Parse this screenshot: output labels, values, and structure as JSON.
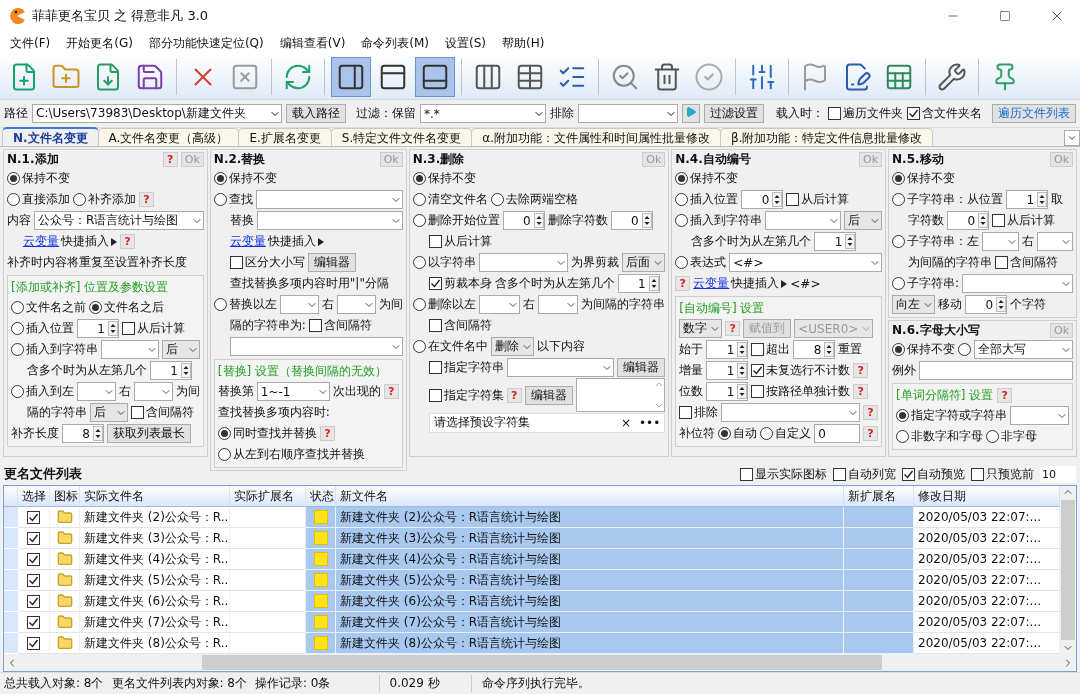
{
  "window": {
    "title": "菲菲更名宝贝 之 得意非凡 3.0"
  },
  "menu": [
    "文件(F)",
    "开始更名(G)",
    "部分功能快速定位(Q)",
    "编辑查看(V)",
    "命令列表(M)",
    "设置(S)",
    "帮助(H)"
  ],
  "toolbar": {
    "groups": [
      [
        {
          "selected": false
        },
        {
          "selected": false
        },
        {
          "selected": false
        },
        {
          "selected": false
        }
      ],
      [
        {
          "selected": false
        },
        {
          "selected": false
        }
      ],
      [
        {
          "selected": false
        }
      ],
      [
        {
          "selected": true
        },
        {
          "selected": false
        },
        {
          "selected": true
        }
      ],
      [
        {
          "selected": false
        },
        {
          "selected": false
        },
        {
          "selected": false
        }
      ],
      [
        {
          "selected": false
        },
        {
          "selected": false
        },
        {
          "selected": false
        }
      ],
      [
        {
          "selected": false
        }
      ],
      [
        {
          "selected": false
        },
        {
          "selected": false
        },
        {
          "selected": false
        }
      ],
      [
        {
          "selected": false
        }
      ],
      [
        {
          "selected": false
        }
      ]
    ]
  },
  "path_bar": {
    "path_label": "路径",
    "path": "C:\\Users\\73983\\Desktop\\新建文件夹",
    "load_button": "载入路径",
    "filter_label": "过滤：保留",
    "filter": "*.*",
    "exclude_label": "排除",
    "filter_settings_button": "过滤设置",
    "on_load_label": "载入时：",
    "options": [
      {
        "label": "遍历文件夹",
        "checked": false
      },
      {
        "label": "含文件夹名",
        "checked": true
      }
    ],
    "traverse_button": "遍历文件列表"
  },
  "tabs": [
    {
      "label": "N.文件名变更",
      "selected": true
    },
    {
      "label": "A.文件名变更（高级）",
      "selected": false
    },
    {
      "label": "E.扩展名变更",
      "selected": false
    },
    {
      "label": "S.特定文件文件名变更",
      "selected": false
    },
    {
      "label": "α.附加功能：文件属性和时间属性批量修改",
      "selected": false
    },
    {
      "label": "β.附加功能：特定文件信息批量修改",
      "selected": false
    }
  ],
  "columns": [
    {
      "panels": [
        {
          "title": "N.1.添加",
          "help": "?",
          "ok": {
            "label": "Ok",
            "disabled": true
          },
          "lines": [
            {
              "items": [
                {
                  "kind": "radio",
                  "label": "保持不变",
                  "selected": true
                }
              ]
            },
            {
              "items": [
                {
                  "kind": "radio",
                  "label": "直接添加",
                  "selected": false
                },
                {
                  "kind": "radio",
                  "label": "补齐添加",
                  "selected": false
                },
                {
                  "kind": "help",
                  "text": "?"
                }
              ]
            },
            {
              "items": [
                {
                  "kind": "text",
                  "text": "内容"
                },
                {
                  "kind": "combo",
                  "value": "公众号：R语言统计与绘图"
                }
              ],
              "children": [
                {
                  "items": [
                    {
                      "kind": "link",
                      "link": "云变量",
                      "text": "快捷插入"
                    },
                    {
                      "kind": "help",
                      "text": "?"
                    }
                  ]
                }
              ]
            },
            {
              "items": [
                {
                  "kind": "text",
                  "text": "补齐时内容将重复至设置补齐长度"
                }
              ]
            }
          ],
          "sections": [
            {
              "title": "[添加或补齐] 位置及参数设置",
              "lines": [
                {
                  "items": [
                    {
                      "kind": "radio",
                      "label": "文件名之前",
                      "selected": false
                    },
                    {
                      "kind": "radio",
                      "label": "文件名之后",
                      "selected": true
                    }
                  ]
                },
                {
                  "items": [
                    {
                      "kind": "radio",
                      "label": "插入位置",
                      "selected": false
                    },
                    {
                      "kind": "spin",
                      "value": "1"
                    },
                    {
                      "kind": "check",
                      "label": "从后计算",
                      "checked": false
                    }
                  ]
                },
                {
                  "items": [
                    {
                      "kind": "radio",
                      "label": "插入到字符串",
                      "selected": false
                    },
                    {
                      "kind": "combo"
                    },
                    {
                      "kind": "select",
                      "value": "后"
                    }
                  ],
                  "children": [
                    {
                      "items": [
                        {
                          "kind": "text",
                          "text": "含多个时为从左第几个"
                        },
                        {
                          "kind": "spin",
                          "value": "1"
                        }
                      ]
                    }
                  ]
                },
                {
                  "items": [
                    {
                      "kind": "radio",
                      "label": "插入到左",
                      "selected": false
                    },
                    {
                      "kind": "combo"
                    },
                    {
                      "kind": "text",
                      "text": "右"
                    },
                    {
                      "kind": "combo"
                    },
                    {
                      "kind": "text",
                      "text": "为间"
                    }
                  ],
                  "children": [
                    {
                      "items": [
                        {
                          "kind": "text",
                          "text": "隔的字符串"
                        },
                        {
                          "kind": "select",
                          "value": "后"
                        },
                        {
                          "kind": "check",
                          "label": "含间隔符",
                          "checked": false
                        }
                      ]
                    }
                  ]
                },
                {
                  "items": [
                    {
                      "kind": "text",
                      "text": "补齐长度"
                    },
                    {
                      "kind": "spin",
                      "value": "8"
                    },
                    {
                      "kind": "button",
                      "label": "获取列表最长"
                    }
                  ]
                }
              ]
            }
          ]
        }
      ]
    },
    {
      "panels": [
        {
          "title": "N.2.替换",
          "ok": {
            "label": "Ok",
            "disabled": true
          },
          "lines": [
            {
              "items": [
                {
                  "kind": "radio",
                  "label": "保持不变",
                  "selected": true
                }
              ]
            },
            {
              "items": [
                {
                  "kind": "radio",
                  "label": "查找",
                  "selected": false
                },
                {
                  "kind": "combo"
                }
              ],
              "children": [
                {
                  "items": [
                    {
                      "kind": "text",
                      "text": "替换"
                    },
                    {
                      "kind": "combo"
                    }
                  ]
                },
                {
                  "items": [
                    {
                      "kind": "link",
                      "link": "云变量",
                      "text": "快捷插入"
                    }
                  ]
                },
                {
                  "items": [
                    {
                      "kind": "check",
                      "label": "区分大小写",
                      "checked": false
                    },
                    {
                      "kind": "button",
                      "label": "编辑器"
                    }
                  ]
                },
                {
                  "items": [
                    {
                      "kind": "text",
                      "text": "查找替换多项内容时用\"|\"分隔"
                    }
                  ]
                }
              ]
            },
            {
              "items": [
                {
                  "kind": "radio",
                  "label": "替换以左",
                  "selected": false
                },
                {
                  "kind": "combo"
                },
                {
                  "kind": "text",
                  "text": "右"
                },
                {
                  "kind": "combo"
                },
                {
                  "kind": "text",
                  "text": "为间"
                }
              ],
              "children": [
                {
                  "items": [
                    {
                      "kind": "text",
                      "text": "隔的字符串为:"
                    },
                    {
                      "kind": "check",
                      "label": "含间隔符",
                      "checked": false
                    }
                  ]
                },
                {
                  "items": [
                    {
                      "kind": "combo"
                    }
                  ]
                }
              ]
            }
          ],
          "sections": [
            {
              "title": "[替换] 设置（替换间隔的无效）",
              "lines": [
                {
                  "items": [
                    {
                      "kind": "text",
                      "text": "替换第"
                    },
                    {
                      "kind": "combo",
                      "value": "1~-1"
                    },
                    {
                      "kind": "text",
                      "text": "次出现的"
                    },
                    {
                      "kind": "help",
                      "text": "?"
                    }
                  ]
                },
                {
                  "items": [
                    {
                      "kind": "text",
                      "text": "查找替换多项内容时:"
                    }
                  ]
                },
                {
                  "items": [
                    {
                      "kind": "radio",
                      "label": "同时查找并替换",
                      "selected": true
                    },
                    {
                      "kind": "help",
                      "text": "?"
                    }
                  ]
                },
                {
                  "items": [
                    {
                      "kind": "radio",
                      "label": "从左到右顺序查找并替换",
                      "selected": false
                    }
                  ]
                }
              ]
            }
          ]
        }
      ]
    },
    {
      "panels": [
        {
          "title": "N.3.删除",
          "ok": {
            "label": "Ok",
            "disabled": true
          },
          "lines": [
            {
              "items": [
                {
                  "kind": "radio",
                  "label": "保持不变",
                  "selected": true
                }
              ]
            },
            {
              "items": [
                {
                  "kind": "radio",
                  "label": "清空文件名",
                  "selected": false
                },
                {
                  "kind": "radio",
                  "label": "去除两端空格",
                  "selected": false
                }
              ]
            },
            {
              "items": [
                {
                  "kind": "radio",
                  "label": "删除开始位置",
                  "selected": false
                },
                {
                  "kind": "spin",
                  "value": "0"
                },
                {
                  "kind": "text",
                  "text": "删除字符数"
                },
                {
                  "kind": "spin",
                  "value": "0"
                }
              ],
              "children": [
                {
                  "items": [
                    {
                      "kind": "check",
                      "label": "从后计算",
                      "checked": false
                    }
                  ]
                }
              ]
            },
            {
              "items": [
                {
                  "kind": "radio",
                  "label": "以字符串",
                  "selected": false
                },
                {
                  "kind": "combo"
                },
                {
                  "kind": "text",
                  "text": "为界剪裁"
                },
                {
                  "kind": "select",
                  "value": "后面"
                }
              ],
              "children": [
                {
                  "items": [
                    {
                      "kind": "check",
                      "label": "剪裁本身",
                      "checked": true
                    },
                    {
                      "kind": "text",
                      "text": "含多个时为从左第几个"
                    },
                    {
                      "kind": "spin",
                      "value": "1"
                    }
                  ]
                }
              ]
            },
            {
              "items": [
                {
                  "kind": "radio",
                  "label": "删除以左",
                  "selected": false
                },
                {
                  "kind": "combo"
                },
                {
                  "kind": "text",
                  "text": "右"
                },
                {
                  "kind": "combo"
                },
                {
                  "kind": "text",
                  "text": "为间隔的字符串"
                }
              ],
              "children": [
                {
                  "items": [
                    {
                      "kind": "check",
                      "label": "含间隔符",
                      "checked": false
                    }
                  ]
                }
              ]
            },
            {
              "items": [
                {
                  "kind": "radio",
                  "label": "在文件名中",
                  "selected": false
                },
                {
                  "kind": "select",
                  "value": "删除"
                },
                {
                  "kind": "text",
                  "text": "以下内容"
                }
              ],
              "children": [
                {
                  "items": [
                    {
                      "kind": "check",
                      "label": "指定字符串",
                      "checked": false
                    },
                    {
                      "kind": "combo"
                    },
                    {
                      "kind": "button",
                      "label": "编辑器"
                    }
                  ]
                },
                {
                  "items": [
                    {
                      "kind": "check",
                      "label": "指定字符集",
                      "checked": false
                    },
                    {
                      "kind": "help",
                      "text": "?"
                    },
                    {
                      "kind": "button",
                      "label": "编辑器"
                    },
                    {
                      "kind": "memo"
                    }
                  ]
                },
                {
                  "items": [
                    {
                      "kind": "picker",
                      "value": "请选择预设字符集",
                      "clear": "×",
                      "more": "•••"
                    }
                  ]
                }
              ]
            }
          ]
        }
      ]
    },
    {
      "panels": [
        {
          "title": "N.4.自动编号",
          "ok": {
            "label": "Ok",
            "disabled": true
          },
          "lines": [
            {
              "items": [
                {
                  "kind": "radio",
                  "label": "保持不变",
                  "selected": true
                }
              ]
            },
            {
              "items": [
                {
                  "kind": "radio",
                  "label": "插入位置",
                  "selected": false
                },
                {
                  "kind": "spin",
                  "value": "0"
                },
                {
                  "kind": "check",
                  "label": "从后计算",
                  "checked": false
                }
              ]
            },
            {
              "items": [
                {
                  "kind": "radio",
                  "label": "插入到字符串",
                  "selected": false
                },
                {
                  "kind": "combo"
                },
                {
                  "kind": "select",
                  "value": "后"
                }
              ],
              "children": [
                {
                  "items": [
                    {
                      "kind": "text",
                      "text": "含多个时为从左第几个"
                    },
                    {
                      "kind": "spin",
                      "value": "1"
                    }
                  ]
                }
              ]
            },
            {
              "items": [
                {
                  "kind": "radio",
                  "label": "表达式",
                  "selected": false
                },
                {
                  "kind": "combo",
                  "value": "<#>"
                }
              ]
            },
            {
              "items": [
                {
                  "kind": "help",
                  "text": "?"
                },
                {
                  "kind": "link",
                  "link": "云变量",
                  "text": "快捷插入"
                },
                {
                  "kind": "text",
                  "text": "<#>"
                }
              ]
            }
          ],
          "sections": [
            {
              "title": "[自动编号] 设置",
              "lines": [
                {
                  "items": [
                    {
                      "kind": "select",
                      "value": "数字"
                    },
                    {
                      "kind": "help",
                      "text": "?"
                    },
                    {
                      "kind": "button",
                      "label": "赋值到",
                      "disabled": true
                    },
                    {
                      "kind": "select",
                      "value": "<USER0>",
                      "disabled": true
                    }
                  ]
                },
                {
                  "items": [
                    {
                      "kind": "text",
                      "text": "始于"
                    },
                    {
                      "kind": "spin",
                      "value": "1"
                    },
                    {
                      "kind": "check",
                      "label": "超出",
                      "checked": false
                    },
                    {
                      "kind": "spin",
                      "value": "8"
                    },
                    {
                      "kind": "text",
                      "text": "重置"
                    }
                  ]
                },
                {
                  "items": [
                    {
                      "kind": "text",
                      "text": "增量"
                    },
                    {
                      "kind": "spin",
                      "value": "1"
                    },
                    {
                      "kind": "check",
                      "label": "未复选行不计数",
                      "checked": true
                    },
                    {
                      "kind": "help",
                      "text": "?"
                    }
                  ]
                },
                {
                  "items": [
                    {
                      "kind": "text",
                      "text": "位数"
                    },
                    {
                      "kind": "spin",
                      "value": "1"
                    },
                    {
                      "kind": "check",
                      "label": "按路径单独计数",
                      "checked": false
                    },
                    {
                      "kind": "help",
                      "text": "?"
                    }
                  ]
                },
                {
                  "items": [
                    {
                      "kind": "check",
                      "label": "排除",
                      "checked": false
                    },
                    {
                      "kind": "combo"
                    },
                    {
                      "kind": "help",
                      "text": "?"
                    }
                  ]
                },
                {
                  "items": [
                    {
                      "kind": "text",
                      "text": "补位符"
                    },
                    {
                      "kind": "radio",
                      "label": "自动",
                      "selected": true
                    },
                    {
                      "kind": "radio",
                      "label": "自定义",
                      "selected": false
                    },
                    {
                      "kind": "input",
                      "value": "0"
                    },
                    {
                      "kind": "help",
                      "text": "?"
                    }
                  ]
                }
              ]
            }
          ]
        }
      ]
    },
    {
      "panels": [
        {
          "title": "N.5.移动",
          "ok": {
            "label": "Ok",
            "disabled": true
          },
          "lines": [
            {
              "items": [
                {
                  "kind": "radio",
                  "label": "保持不变",
                  "selected": true
                }
              ]
            },
            {
              "items": [
                {
                  "kind": "radio",
                  "label": "子字符串：从位置",
                  "selected": false
                },
                {
                  "kind": "spin",
                  "value": "1"
                },
                {
                  "kind": "text",
                  "text": "取"
                }
              ],
              "children": [
                {
                  "items": [
                    {
                      "kind": "text",
                      "text": "字符数"
                    },
                    {
                      "kind": "spin",
                      "value": "0"
                    },
                    {
                      "kind": "check",
                      "label": "从后计算",
                      "checked": false
                    }
                  ]
                }
              ]
            },
            {
              "items": [
                {
                  "kind": "radio",
                  "label": "子字符串：左",
                  "selected": false
                },
                {
                  "kind": "combo"
                },
                {
                  "kind": "text",
                  "text": "右"
                },
                {
                  "kind": "combo"
                }
              ],
              "children": [
                {
                  "items": [
                    {
                      "kind": "text",
                      "text": "为间隔的字符串"
                    },
                    {
                      "kind": "check",
                      "label": "含间隔符",
                      "checked": false
                    }
                  ]
                }
              ]
            },
            {
              "items": [
                {
                  "kind": "radio",
                  "label": "子字符串:",
                  "selected": false
                },
                {
                  "kind": "combo"
                }
              ]
            },
            {
              "items": [
                {
                  "kind": "select",
                  "value": "向左"
                },
                {
                  "kind": "text",
                  "text": "移动"
                },
                {
                  "kind": "spin",
                  "value": "0"
                },
                {
                  "kind": "text",
                  "text": "个字符"
                }
              ]
            }
          ]
        },
        {
          "title": "N.6.字母大小写",
          "ok": {
            "label": "Ok",
            "disabled": true
          },
          "lines": [
            {
              "items": [
                {
                  "kind": "radio",
                  "label": "保持不变",
                  "selected": true
                },
                {
                  "kind": "radio",
                  "selected": false
                },
                {
                  "kind": "combo",
                  "value": "全部大写"
                }
              ]
            },
            {
              "items": [
                {
                  "kind": "text",
                  "text": "例外"
                },
                {
                  "kind": "input"
                }
              ]
            }
          ],
          "sections": [
            {
              "title": "[单词分隔符] 设置",
              "help": "?",
              "lines": [
                {
                  "items": [
                    {
                      "kind": "radio",
                      "label": "指定字符或字符串",
                      "selected": true
                    },
                    {
                      "kind": "combo"
                    }
                  ]
                },
                {
                  "items": [
                    {
                      "kind": "radio",
                      "label": "非数字和字母",
                      "selected": false
                    },
                    {
                      "kind": "radio",
                      "label": "非字母",
                      "selected": false
                    }
                  ]
                }
              ]
            }
          ]
        }
      ]
    }
  ],
  "file_list": {
    "title": "更名文件列表",
    "options": [
      {
        "label": "显示实际图标",
        "checked": false
      },
      {
        "label": "自动列宽",
        "checked": false
      },
      {
        "label": "自动预览",
        "checked": true
      },
      {
        "label": "只预览前",
        "checked": false
      }
    ],
    "preview_count": "10",
    "columns": [
      "选择",
      "图标",
      "实际文件名",
      "实际扩展名",
      "状态",
      "新文件名",
      "新扩展名",
      "修改日期"
    ],
    "rows": [
      {
        "checked": true,
        "name": "新建文件夹 (2)公众号：R...",
        "renamed": true,
        "new_name": "新建文件夹 (2)公众号：R语言统计与绘图",
        "modified": "2020/05/03 22:07:..."
      },
      {
        "checked": true,
        "name": "新建文件夹 (3)公众号：R...",
        "renamed": true,
        "new_name": "新建文件夹 (3)公众号：R语言统计与绘图",
        "modified": "2020/05/03 22:07:..."
      },
      {
        "checked": true,
        "name": "新建文件夹 (4)公众号：R...",
        "renamed": true,
        "new_name": "新建文件夹 (4)公众号：R语言统计与绘图",
        "modified": "2020/05/03 22:07:..."
      },
      {
        "checked": true,
        "name": "新建文件夹 (5)公众号：R...",
        "renamed": true,
        "new_name": "新建文件夹 (5)公众号：R语言统计与绘图",
        "modified": "2020/05/03 22:07:..."
      },
      {
        "checked": true,
        "name": "新建文件夹 (6)公众号：R...",
        "renamed": true,
        "new_name": "新建文件夹 (6)公众号：R语言统计与绘图",
        "modified": "2020/05/03 22:07:..."
      },
      {
        "checked": true,
        "name": "新建文件夹 (7)公众号：R...",
        "renamed": true,
        "new_name": "新建文件夹 (7)公众号：R语言统计与绘图",
        "modified": "2020/05/03 22:07:..."
      },
      {
        "checked": true,
        "name": "新建文件夹 (8)公众号：R...",
        "renamed": true,
        "new_name": "新建文件夹 (8)公众号：R语言统计与绘图",
        "modified": "2020/05/03 22:07:..."
      }
    ]
  },
  "status_bar": {
    "left": [
      "总共载入对象: 8个",
      "更名文件列表内对象: 8个",
      "操作记录: 0条"
    ],
    "time": "0.029 秒",
    "message": "命令序列执行完毕。"
  }
}
